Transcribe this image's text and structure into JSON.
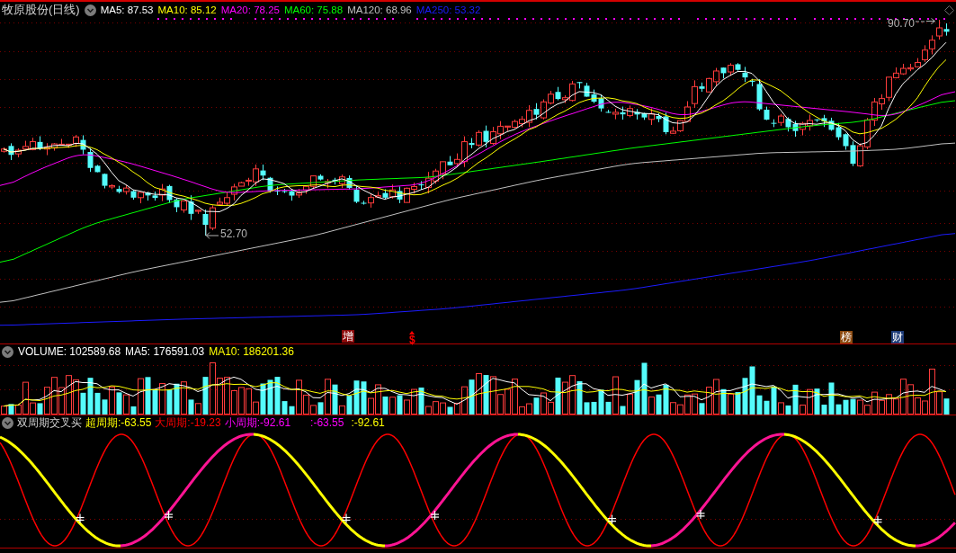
{
  "main_chart": {
    "title": "牧原股份(日线)",
    "ma_legend": [
      {
        "text": "MA5: 87.53",
        "color": "#ffffff"
      },
      {
        "text": "MA10: 85.12",
        "color": "#ffff00"
      },
      {
        "text": "MA20: 78.25",
        "color": "#ff00ff"
      },
      {
        "text": "MA60: 75.88",
        "color": "#00ff00"
      },
      {
        "text": "MA120: 68.96",
        "color": "#c0c0c0"
      },
      {
        "text": "MA250: 53.32",
        "color": "#1c1cff"
      }
    ],
    "price_labels": [
      {
        "text": "90.70",
        "kind": "high"
      },
      {
        "text": "52.70",
        "kind": "low"
      }
    ],
    "event_markers": [
      {
        "text": "增",
        "kind": "tag",
        "color": "#8c0a0a"
      },
      {
        "text": "$",
        "kind": "arrow",
        "color": "#ff0000"
      },
      {
        "text": "榜",
        "kind": "tag",
        "color": "#8c4a10"
      },
      {
        "text": "财",
        "kind": "tag",
        "color": "#1e3c78"
      }
    ]
  },
  "volume_chart": {
    "legend": [
      {
        "text": "VOLUME: 102589.68",
        "color": "#ffffff"
      },
      {
        "text": "MA5: 176591.03",
        "color": "#ffffff"
      },
      {
        "text": "MA10: 186201.36",
        "color": "#ffff00"
      }
    ]
  },
  "indicator_chart": {
    "title": "双周期交叉买",
    "legend": [
      {
        "text": "超周期:-63.55",
        "color": "#ffff00"
      },
      {
        "text": "大周期:-19.23",
        "color": "#ff0000"
      },
      {
        "text": "小周期:-92.61",
        "color": "#ff00ff"
      },
      {
        "text": ":-63.55",
        "color": "#ff00ff"
      },
      {
        "text": ":-92.61",
        "color": "#ffff00"
      }
    ]
  }
}
